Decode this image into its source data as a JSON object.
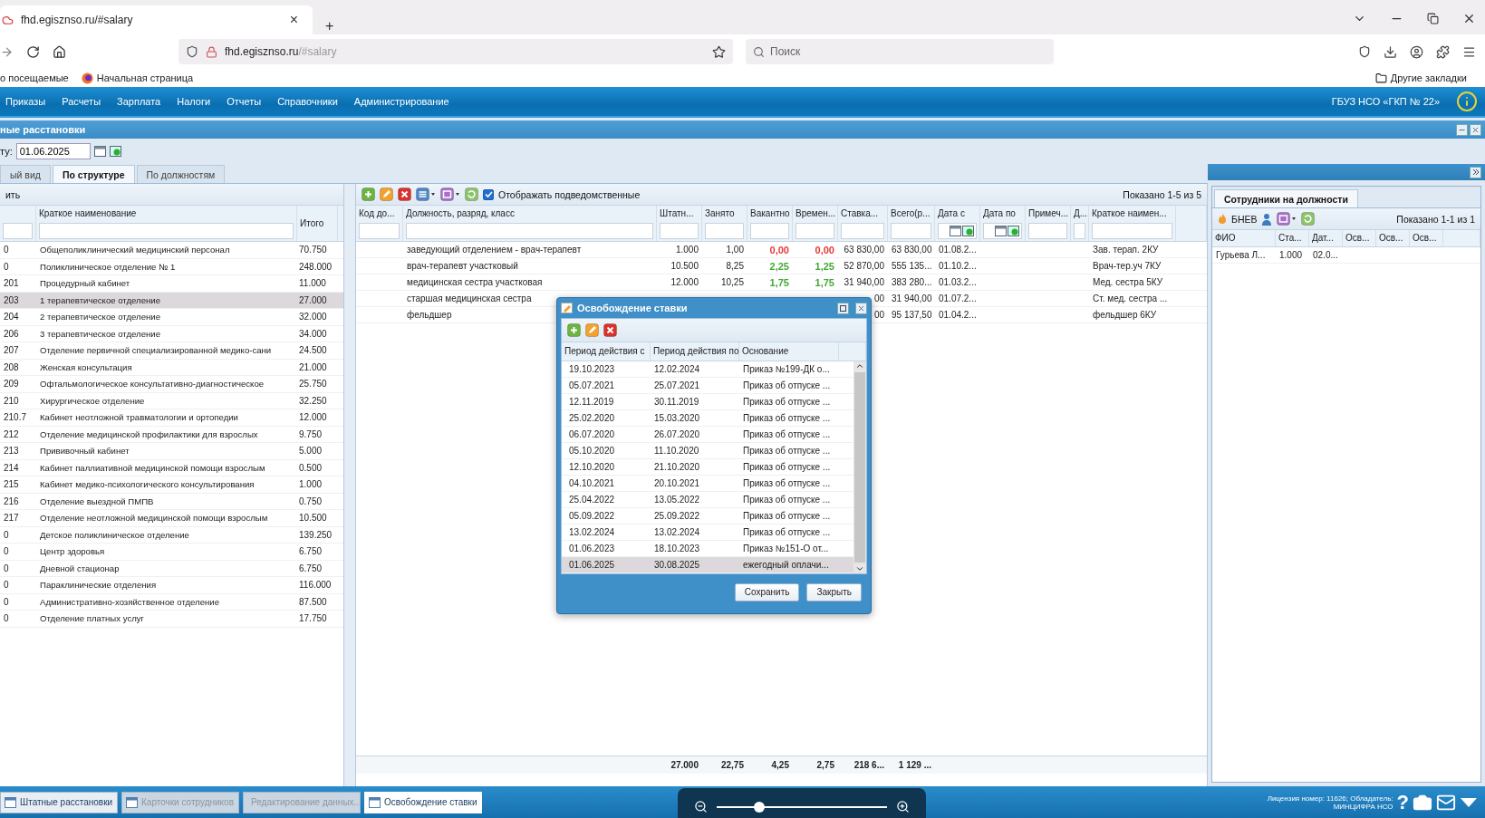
{
  "browser": {
    "tab_title": "fhd.egisznso.ru/#salary",
    "tab_close": "×",
    "new_tab": "+",
    "url_host": "fhd.egisznso.ru",
    "url_path": "/#salary",
    "search_placeholder": "Поиск",
    "bookmarks": [
      {
        "label": "о посещаемые",
        "kind": "plain"
      },
      {
        "label": "Начальная страница",
        "kind": "browser"
      }
    ],
    "other_bookmarks": "Другие закладки"
  },
  "app_menu": {
    "items": [
      "Приказы",
      "Расчеты",
      "Зарплата",
      "Налоги",
      "Отчеты",
      "Справочники",
      "Администрирование"
    ],
    "org": "ГБУЗ НСО «ГКП № 22»"
  },
  "panel": {
    "title": "ные расстановки",
    "date_label": "ту:",
    "date_value": "01.06.2025",
    "tabs": [
      {
        "label": "ый вид",
        "selected": false
      },
      {
        "label": "По структуре",
        "selected": true
      },
      {
        "label": "По должностям",
        "selected": false
      }
    ]
  },
  "structure": {
    "toolbar_label": "ить",
    "columns": [
      "Краткое наименование",
      "Итого"
    ],
    "rows": [
      {
        "code": "0",
        "name": "Общеполиклинический медицинский персонал",
        "total": "70.750",
        "selected": false
      },
      {
        "code": "0",
        "name": "Поликлиническое отделение № 1",
        "total": "248.000",
        "selected": false
      },
      {
        "code": "201",
        "name": "Процедурный кабинет",
        "total": "11.000",
        "selected": false
      },
      {
        "code": "203",
        "name": "1 терапевтическое отделение",
        "total": "27.000",
        "selected": true
      },
      {
        "code": "204",
        "name": "2 терапевтическое отделение",
        "total": "32.000",
        "selected": false
      },
      {
        "code": "206",
        "name": "3 терапевтическое отделение",
        "total": "34.000",
        "selected": false
      },
      {
        "code": "207",
        "name": "Отделение первичной специализированной медико-сани",
        "total": "24.500",
        "selected": false
      },
      {
        "code": "208",
        "name": "Женская консультация",
        "total": "21.000",
        "selected": false
      },
      {
        "code": "209",
        "name": "Офтальмологическое консультативно-диагностическое",
        "total": "25.750",
        "selected": false
      },
      {
        "code": "210",
        "name": "Хирургическое отделение",
        "total": "32.250",
        "selected": false
      },
      {
        "code": "210.7",
        "name": "Кабинет неотложной травматологии и ортопедии",
        "total": "12.000",
        "selected": false
      },
      {
        "code": "212",
        "name": "Отделение медицинской профилактики для взрослых",
        "total": "9.750",
        "selected": false
      },
      {
        "code": "213",
        "name": "Прививочный кабинет",
        "total": "5.000",
        "selected": false
      },
      {
        "code": "214",
        "name": "Кабинет паллиативной медицинской помощи взрослым",
        "total": "0.500",
        "selected": false
      },
      {
        "code": "215",
        "name": "Кабинет медико-психологического консультирования",
        "total": "1.000",
        "selected": false
      },
      {
        "code": "216",
        "name": "Отделение выездной ПМПВ",
        "total": "0.750",
        "selected": false
      },
      {
        "code": "217",
        "name": "Отделение неотложной медицинской помощи взрослым",
        "total": "10.500",
        "selected": false
      },
      {
        "code": "0",
        "name": "Детское поликлиническое отделение",
        "total": "139.250",
        "selected": false
      },
      {
        "code": "0",
        "name": "Центр здоровья",
        "total": "6.750",
        "selected": false
      },
      {
        "code": "0",
        "name": "Дневной стационар",
        "total": "6.750",
        "selected": false
      },
      {
        "code": "0",
        "name": "Параклинические отделения",
        "total": "116.000",
        "selected": false
      },
      {
        "code": "0",
        "name": "Административно-хозяйственное отделение",
        "total": "87.500",
        "selected": false
      },
      {
        "code": "0",
        "name": "Отделение платных услуг",
        "total": "17.750",
        "selected": false
      }
    ]
  },
  "positions": {
    "show_subordinate": {
      "label": "Отображать подведомственные",
      "checked": true
    },
    "paging": "Показано 1-5 из 5",
    "columns": [
      "Код до...",
      "Должность, разряд, класс",
      "Штатн...",
      "Занято",
      "Вакантно",
      "Времен...",
      "Ставка...",
      "Всего(р...",
      "Дата с",
      "Дата по",
      "Примеч...",
      "Д...",
      "Краткое наимен..."
    ],
    "rows": [
      {
        "position": "заведующий отделением - врач-терапевт",
        "staff": "1.000",
        "occupied": "1,00",
        "vacant": "0,00",
        "temporary": "0,00",
        "color": "#e53935",
        "rate": "63 830,00",
        "sum": "63 830,00",
        "date_from": "01.08.2...",
        "short_name": "Зав. терап. 2КУ"
      },
      {
        "position": "врач-терапевт участковый",
        "staff": "10.500",
        "occupied": "8,25",
        "vacant": "2,25",
        "temporary": "1,25",
        "color": "#43a832",
        "rate": "52 870,00",
        "sum": "555 135...",
        "date_from": "01.10.2...",
        "short_name": "Врач-тер.уч 7КУ"
      },
      {
        "position": "медицинская сестра участковая",
        "staff": "12.000",
        "occupied": "10,25",
        "vacant": "1,75",
        "temporary": "1,75",
        "color": "#43a832",
        "rate": "31 940,00",
        "sum": "383 280...",
        "date_from": "01.03.2...",
        "short_name": "Мед. сестра 5КУ"
      },
      {
        "position": "старшая медицинская сестра",
        "rate": "00",
        "sum": "31 940,00",
        "date_from": "01.07.2...",
        "short_name": "Ст. мед. сестра ..."
      },
      {
        "position": "фельдшер",
        "rate": "00",
        "sum": "95 137,50",
        "date_from": "01.04.2...",
        "short_name": "фельдшер 6КУ"
      }
    ],
    "totals": {
      "staff": "27.000",
      "occupied": "22,75",
      "vacant": "4,25",
      "temporary": "2,75",
      "rate": "218 6...",
      "sum": "1 129 ..."
    }
  },
  "employees": {
    "tab": "Сотрудники на должности",
    "toolbar_label": "БНЕВ",
    "paging": "Показано 1-1 из 1",
    "columns": [
      "ФИО",
      "Ста...",
      "Дат...",
      "Осв...",
      "Осв...",
      "Осв..."
    ],
    "rows": [
      {
        "name": "Гурьева Л...",
        "rate": "1.000",
        "date": "02.0..."
      }
    ]
  },
  "dialog": {
    "title": "Освобождение ставки",
    "columns": [
      "Период действия с",
      "Период действия по",
      "Основание"
    ],
    "rows": [
      {
        "from": "19.10.2023",
        "to": "12.02.2024",
        "basis": "Приказ №199-ДК о...",
        "selected": false
      },
      {
        "from": "05.07.2021",
        "to": "25.07.2021",
        "basis": "Приказ об отпуске ...",
        "selected": false
      },
      {
        "from": "12.11.2019",
        "to": "30.11.2019",
        "basis": "Приказ об отпуске ...",
        "selected": false
      },
      {
        "from": "25.02.2020",
        "to": "15.03.2020",
        "basis": "Приказ об отпуске ...",
        "selected": false
      },
      {
        "from": "06.07.2020",
        "to": "26.07.2020",
        "basis": "Приказ об отпуске ...",
        "selected": false
      },
      {
        "from": "05.10.2020",
        "to": "11.10.2020",
        "basis": "Приказ об отпуске ...",
        "selected": false
      },
      {
        "from": "12.10.2020",
        "to": "21.10.2020",
        "basis": "Приказ об отпуске ...",
        "selected": false
      },
      {
        "from": "04.10.2021",
        "to": "20.10.2021",
        "basis": "Приказ об отпуске ...",
        "selected": false
      },
      {
        "from": "25.04.2022",
        "to": "13.05.2022",
        "basis": "Приказ об отпуске ...",
        "selected": false
      },
      {
        "from": "05.09.2022",
        "to": "25.09.2022",
        "basis": "Приказ об отпуске ...",
        "selected": false
      },
      {
        "from": "13.02.2024",
        "to": "13.02.2024",
        "basis": "Приказ об отпуске ...",
        "selected": false
      },
      {
        "from": "01.06.2023",
        "to": "18.10.2023",
        "basis": "Приказ №151-О от...",
        "selected": false
      },
      {
        "from": "01.06.2025",
        "to": "30.08.2025",
        "basis": "ежегодный оплачи...",
        "selected": true
      }
    ],
    "buttons": [
      "Сохранить",
      "Закрыть"
    ]
  },
  "taskbar": {
    "items": [
      {
        "label": "Штатные расстановки",
        "selected": false,
        "disabled": false
      },
      {
        "label": "Карточки сотрудников",
        "selected": false,
        "disabled": true
      },
      {
        "label": "Редактирование данных...",
        "selected": false,
        "disabled": true
      },
      {
        "label": "Освобождение ставки",
        "selected": true,
        "disabled": false
      }
    ],
    "license": "Лицензия номер: 11626; Обладатель: МИНЦИФРА НСО",
    "help": "?"
  },
  "zoom_slider": {
    "level": 0.25
  }
}
